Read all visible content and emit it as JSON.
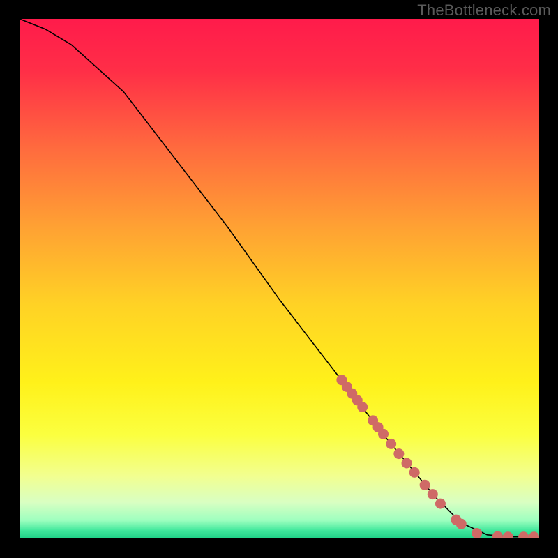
{
  "watermark": "TheBottleneck.com",
  "chart_data": {
    "type": "line",
    "title": "",
    "xlabel": "",
    "ylabel": "",
    "xlim": [
      0,
      100
    ],
    "ylim": [
      0,
      100
    ],
    "curve": [
      {
        "x": 0,
        "y": 100
      },
      {
        "x": 5,
        "y": 98
      },
      {
        "x": 10,
        "y": 95
      },
      {
        "x": 20,
        "y": 86
      },
      {
        "x": 30,
        "y": 73
      },
      {
        "x": 40,
        "y": 60
      },
      {
        "x": 50,
        "y": 46
      },
      {
        "x": 60,
        "y": 33
      },
      {
        "x": 70,
        "y": 20
      },
      {
        "x": 75,
        "y": 14
      },
      {
        "x": 80,
        "y": 8
      },
      {
        "x": 85,
        "y": 3
      },
      {
        "x": 90,
        "y": 0.7
      },
      {
        "x": 95,
        "y": 0.3
      },
      {
        "x": 100,
        "y": 0.3
      }
    ],
    "markers": [
      {
        "x": 62,
        "y": 30.5
      },
      {
        "x": 63,
        "y": 29.2
      },
      {
        "x": 64,
        "y": 27.9
      },
      {
        "x": 65,
        "y": 26.6
      },
      {
        "x": 66,
        "y": 25.3
      },
      {
        "x": 68,
        "y": 22.7
      },
      {
        "x": 69,
        "y": 21.4
      },
      {
        "x": 70,
        "y": 20.1
      },
      {
        "x": 71.5,
        "y": 18.2
      },
      {
        "x": 73,
        "y": 16.3
      },
      {
        "x": 74.5,
        "y": 14.5
      },
      {
        "x": 76,
        "y": 12.7
      },
      {
        "x": 78,
        "y": 10.3
      },
      {
        "x": 79.5,
        "y": 8.5
      },
      {
        "x": 81,
        "y": 6.7
      },
      {
        "x": 84,
        "y": 3.6
      },
      {
        "x": 85,
        "y": 2.8
      },
      {
        "x": 88,
        "y": 1.0
      },
      {
        "x": 92,
        "y": 0.4
      },
      {
        "x": 94,
        "y": 0.3
      },
      {
        "x": 97,
        "y": 0.3
      },
      {
        "x": 99,
        "y": 0.3
      }
    ],
    "marker_color": "#cf6a66",
    "line_color": "#000000",
    "gradient_stops": [
      {
        "offset": 0.0,
        "color": "#ff1b4b"
      },
      {
        "offset": 0.1,
        "color": "#ff2e47"
      },
      {
        "offset": 0.25,
        "color": "#ff6b3e"
      },
      {
        "offset": 0.4,
        "color": "#ffa133"
      },
      {
        "offset": 0.55,
        "color": "#ffd225"
      },
      {
        "offset": 0.7,
        "color": "#fff11a"
      },
      {
        "offset": 0.8,
        "color": "#fbff3f"
      },
      {
        "offset": 0.88,
        "color": "#f2ff90"
      },
      {
        "offset": 0.93,
        "color": "#d9ffc2"
      },
      {
        "offset": 0.965,
        "color": "#9effbf"
      },
      {
        "offset": 0.985,
        "color": "#3fe89c"
      },
      {
        "offset": 1.0,
        "color": "#1fd187"
      }
    ]
  }
}
